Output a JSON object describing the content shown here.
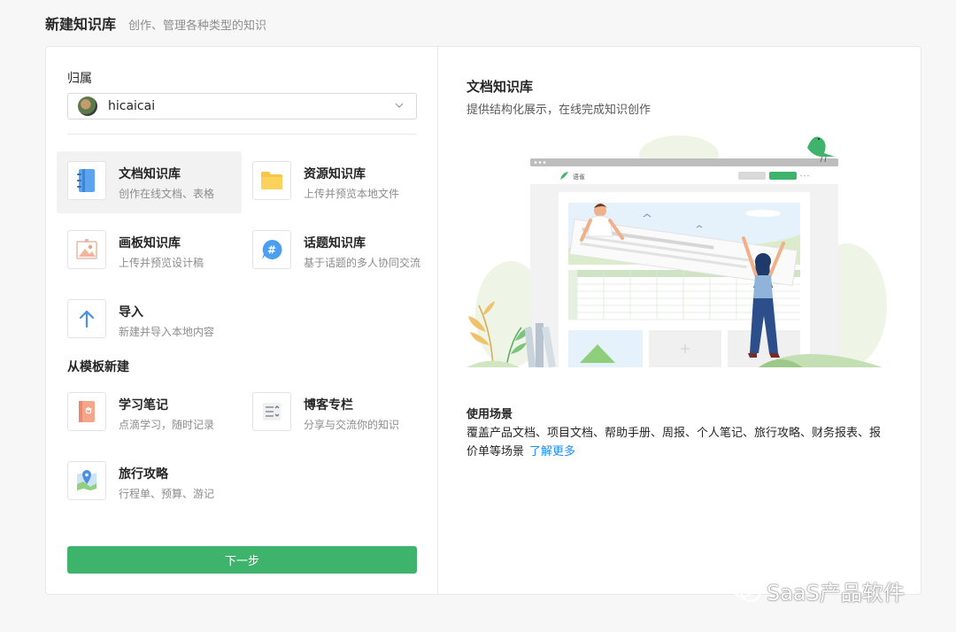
{
  "header": {
    "title": "新建知识库",
    "subtitle": "创作、管理各种类型的知识"
  },
  "owner": {
    "label": "归属",
    "value": "hicaicai"
  },
  "types": [
    {
      "name": "文档知识库",
      "desc": "创作在线文档、表格",
      "icon": "document-book-icon",
      "selected": true
    },
    {
      "name": "资源知识库",
      "desc": "上传并预览本地文件",
      "icon": "folder-icon"
    },
    {
      "name": "画板知识库",
      "desc": "上传并预览设计稿",
      "icon": "image-board-icon"
    },
    {
      "name": "话题知识库",
      "desc": "基于话题的多人协同交流",
      "icon": "hashtag-chat-icon"
    },
    {
      "name": "导入",
      "desc": "新建并导入本地内容",
      "icon": "arrow-up-icon"
    }
  ],
  "template_section": {
    "label": "从模板新建"
  },
  "templates": [
    {
      "name": "学习笔记",
      "desc": "点滴学习，随时记录",
      "icon": "notebook-icon"
    },
    {
      "name": "博客专栏",
      "desc": "分享与交流你的知识",
      "icon": "blog-list-icon"
    },
    {
      "name": "旅行攻略",
      "desc": "行程单、预算、游记",
      "icon": "map-pin-icon"
    }
  ],
  "next_button": {
    "label": "下一步"
  },
  "detail": {
    "title": "文档知识库",
    "desc": "提供结构化展示，在线完成知识创作",
    "illustration_app_name": "语雀",
    "scene_title": "使用场景",
    "scene_desc": "覆盖产品文档、项目文档、帮助手册、周报、个人笔记、旅行攻略、财务报表、报价单等场景",
    "learn_more": "了解更多"
  },
  "watermark": {
    "text": "SaaS产品软件"
  },
  "colors": {
    "primary_green": "#3db36b",
    "link_blue": "#1a8cff"
  }
}
